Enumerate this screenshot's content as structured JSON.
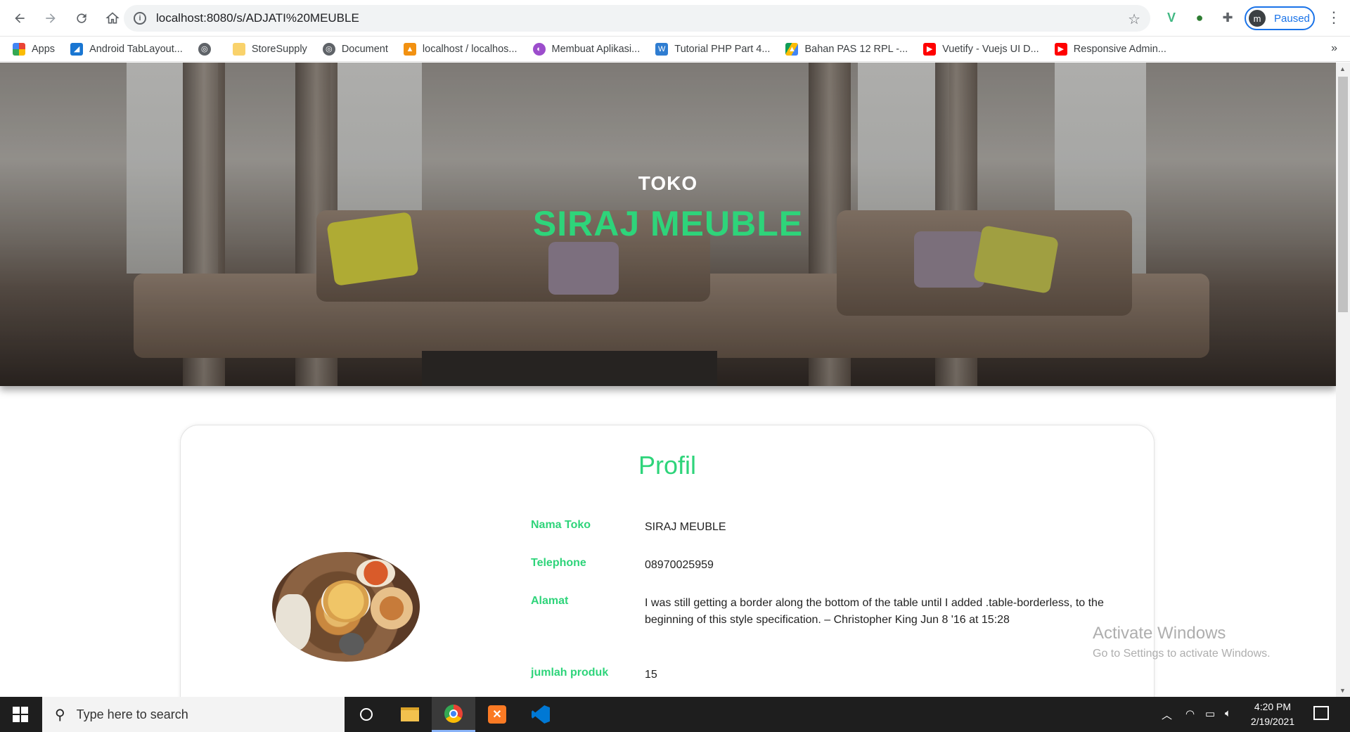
{
  "browser": {
    "url": "localhost:8080/s/ADJATI%20MEUBLE",
    "profile_initial": "m",
    "profile_status": "Paused"
  },
  "bookmarks": [
    {
      "label": "Apps",
      "icon": "apps-grid-icon",
      "color": "#ea4335"
    },
    {
      "label": "Android TabLayout...",
      "icon": "android-bookmark-icon",
      "color": "#1976d2"
    },
    {
      "label": "",
      "icon": "globe-icon",
      "color": "#5f6368"
    },
    {
      "label": "StoreSupply",
      "icon": "folder-icon",
      "color": "#f9d26b"
    },
    {
      "label": "Document",
      "icon": "globe-icon",
      "color": "#5f6368"
    },
    {
      "label": "localhost / localhos...",
      "icon": "phpmyadmin-icon",
      "color": "#f29111"
    },
    {
      "label": "Membuat Aplikasi...",
      "icon": "site-icon",
      "color": "#9c4dcc"
    },
    {
      "label": "Tutorial PHP Part 4...",
      "icon": "w3-icon",
      "color": "#2f7dd1"
    },
    {
      "label": "Bahan PAS 12 RPL -...",
      "icon": "google-drive-icon",
      "color": "#0f9d58"
    },
    {
      "label": "Vuetify - Vuejs UI D...",
      "icon": "youtube-icon",
      "color": "#ff0000"
    },
    {
      "label": "Responsive Admin...",
      "icon": "youtube-icon",
      "color": "#ff0000"
    }
  ],
  "hero": {
    "pre_title": "TOKO",
    "title": "SIRAJ MEUBLE"
  },
  "profile": {
    "heading": "Profil",
    "rows": [
      {
        "label": "Nama Toko",
        "value": "SIRAJ MEUBLE"
      },
      {
        "label": "Telephone",
        "value": "08970025959"
      },
      {
        "label": "Alamat",
        "value": "I was still getting a border along the bottom of the table until I added .table-borderless, to the beginning of this style specification. – Christopher King Jun 8 '16 at 15:28"
      },
      {
        "label": "jumlah produk",
        "value": "15"
      }
    ]
  },
  "watermark": {
    "line1": "Activate Windows",
    "line2": "Go to Settings to activate Windows."
  },
  "taskbar": {
    "search_placeholder": "Type here to search",
    "time": "4:20 PM",
    "date": "2/19/2021"
  },
  "colors": {
    "accent": "#2ed47a",
    "chip": "#1a73e8"
  }
}
